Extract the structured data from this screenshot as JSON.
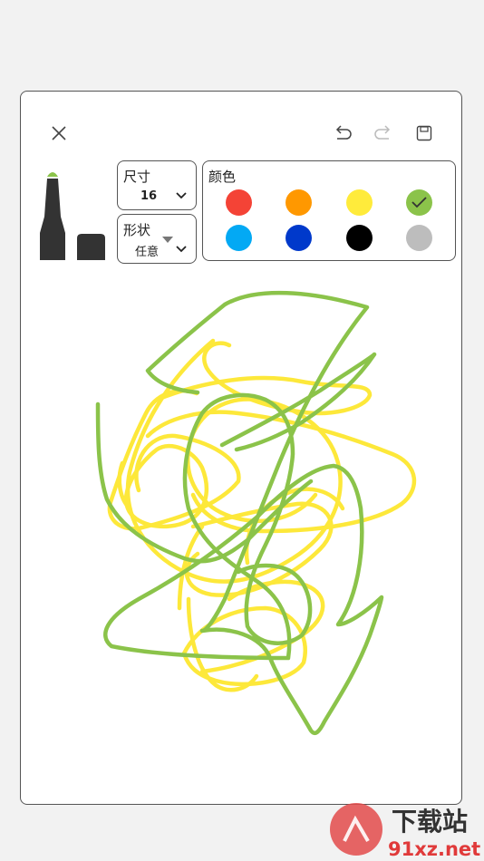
{
  "toolbar": {
    "close_icon": "close-icon",
    "undo_icon": "undo-icon",
    "redo_icon": "redo-icon",
    "save_icon": "save-icon"
  },
  "pen_tools": {
    "items": [
      {
        "name": "marker-pen",
        "icon": "marker-icon"
      },
      {
        "name": "eraser",
        "icon": "eraser-icon"
      }
    ],
    "active_tip_color": "#8bc34a"
  },
  "size": {
    "label": "尺寸",
    "value": "16"
  },
  "shape": {
    "label": "形状",
    "value": "任意"
  },
  "colors": {
    "label": "颜色",
    "swatches": [
      "#f44336",
      "#ff9800",
      "#ffeb3b",
      "#8bc34a",
      "#03a9f4",
      "#0039cb",
      "#000000",
      "#bdbdbd"
    ],
    "selected": "#8bc34a"
  },
  "watermark": {
    "brand": "下载站",
    "domain": "91xz.net"
  }
}
